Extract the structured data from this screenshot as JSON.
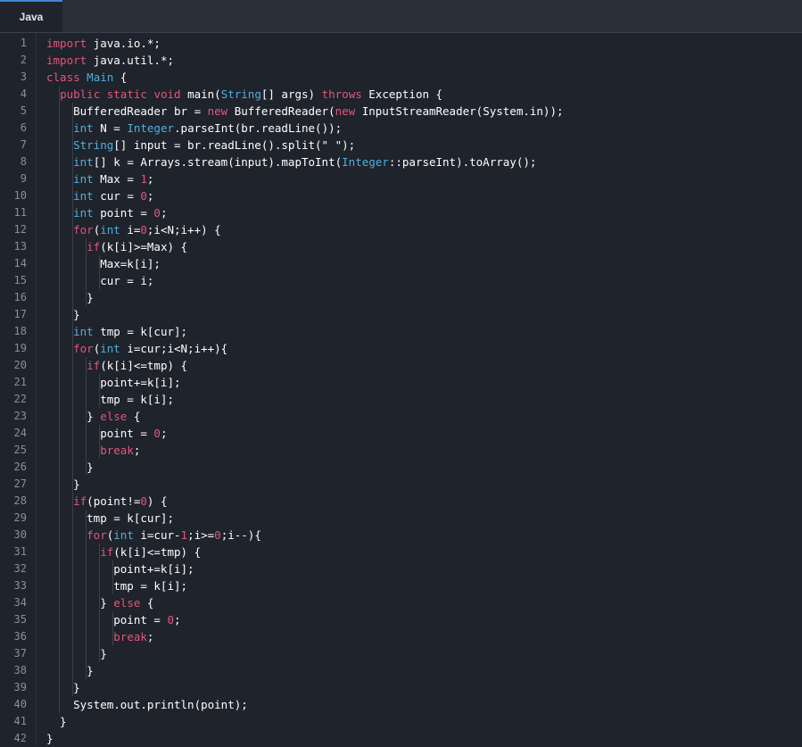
{
  "tab": {
    "label": "Java"
  },
  "colors": {
    "keyword": "#e0577c",
    "type": "#4fb0e0",
    "text": "#ffffff",
    "line_number": "#8a8f99",
    "background": "#1f232b"
  },
  "lines": [
    {
      "n": "1",
      "tokens": [
        [
          "kw",
          "import"
        ],
        [
          "pl",
          " java.io.*;"
        ]
      ]
    },
    {
      "n": "2",
      "tokens": [
        [
          "kw",
          "import"
        ],
        [
          "pl",
          " java.util.*;"
        ]
      ]
    },
    {
      "n": "3",
      "tokens": [
        [
          "kw",
          "class"
        ],
        [
          "pl",
          " "
        ],
        [
          "ty",
          "Main"
        ],
        [
          "pl",
          " {"
        ]
      ]
    },
    {
      "n": "4",
      "tokens": [
        [
          "pl",
          "  "
        ],
        [
          "kw",
          "public"
        ],
        [
          "pl",
          " "
        ],
        [
          "kw",
          "static"
        ],
        [
          "pl",
          " "
        ],
        [
          "kw",
          "void"
        ],
        [
          "pl",
          " main("
        ],
        [
          "ty",
          "String"
        ],
        [
          "pl",
          "[] args) "
        ],
        [
          "kw",
          "throws"
        ],
        [
          "pl",
          " Exception {"
        ]
      ]
    },
    {
      "n": "5",
      "tokens": [
        [
          "pl",
          "    BufferedReader br = "
        ],
        [
          "kw",
          "new"
        ],
        [
          "pl",
          " BufferedReader("
        ],
        [
          "kw",
          "new"
        ],
        [
          "pl",
          " InputStreamReader(System.in));"
        ]
      ]
    },
    {
      "n": "6",
      "tokens": [
        [
          "pl",
          "    "
        ],
        [
          "ty",
          "int"
        ],
        [
          "pl",
          " N = "
        ],
        [
          "ty",
          "Integer"
        ],
        [
          "pl",
          ".parseInt(br.readLine());"
        ]
      ]
    },
    {
      "n": "7",
      "tokens": [
        [
          "pl",
          "    "
        ],
        [
          "ty",
          "String"
        ],
        [
          "pl",
          "[] input = br.readLine().split(\" \");"
        ]
      ]
    },
    {
      "n": "8",
      "tokens": [
        [
          "pl",
          "    "
        ],
        [
          "ty",
          "int"
        ],
        [
          "pl",
          "[] k = Arrays.stream(input).mapToInt("
        ],
        [
          "ty",
          "Integer"
        ],
        [
          "pl",
          "::parseInt).toArray();"
        ]
      ]
    },
    {
      "n": "9",
      "tokens": [
        [
          "pl",
          "    "
        ],
        [
          "ty",
          "int"
        ],
        [
          "pl",
          " Max = "
        ],
        [
          "nu",
          "1"
        ],
        [
          "pl",
          ";"
        ]
      ]
    },
    {
      "n": "10",
      "tokens": [
        [
          "pl",
          "    "
        ],
        [
          "ty",
          "int"
        ],
        [
          "pl",
          " cur = "
        ],
        [
          "nu",
          "0"
        ],
        [
          "pl",
          ";"
        ]
      ]
    },
    {
      "n": "11",
      "tokens": [
        [
          "pl",
          "    "
        ],
        [
          "ty",
          "int"
        ],
        [
          "pl",
          " point = "
        ],
        [
          "nu",
          "0"
        ],
        [
          "pl",
          ";"
        ]
      ]
    },
    {
      "n": "12",
      "tokens": [
        [
          "pl",
          "    "
        ],
        [
          "kw",
          "for"
        ],
        [
          "pl",
          "("
        ],
        [
          "ty",
          "int"
        ],
        [
          "pl",
          " i="
        ],
        [
          "nu",
          "0"
        ],
        [
          "pl",
          ";i<N;i++) {"
        ]
      ]
    },
    {
      "n": "13",
      "tokens": [
        [
          "pl",
          "      "
        ],
        [
          "kw",
          "if"
        ],
        [
          "pl",
          "(k[i]>=Max) {"
        ]
      ]
    },
    {
      "n": "14",
      "tokens": [
        [
          "pl",
          "        Max=k[i];"
        ]
      ]
    },
    {
      "n": "15",
      "tokens": [
        [
          "pl",
          "        cur = i;"
        ]
      ]
    },
    {
      "n": "16",
      "tokens": [
        [
          "pl",
          "      }"
        ]
      ]
    },
    {
      "n": "17",
      "tokens": [
        [
          "pl",
          "    }"
        ]
      ]
    },
    {
      "n": "18",
      "tokens": [
        [
          "pl",
          "    "
        ],
        [
          "ty",
          "int"
        ],
        [
          "pl",
          " tmp = k[cur];"
        ]
      ]
    },
    {
      "n": "19",
      "tokens": [
        [
          "pl",
          "    "
        ],
        [
          "kw",
          "for"
        ],
        [
          "pl",
          "("
        ],
        [
          "ty",
          "int"
        ],
        [
          "pl",
          " i=cur;i<N;i++){"
        ]
      ]
    },
    {
      "n": "20",
      "tokens": [
        [
          "pl",
          "      "
        ],
        [
          "kw",
          "if"
        ],
        [
          "pl",
          "(k[i]<=tmp) {"
        ]
      ]
    },
    {
      "n": "21",
      "tokens": [
        [
          "pl",
          "        point+=k[i];"
        ]
      ]
    },
    {
      "n": "22",
      "tokens": [
        [
          "pl",
          "        tmp = k[i];"
        ]
      ]
    },
    {
      "n": "23",
      "tokens": [
        [
          "pl",
          "      } "
        ],
        [
          "kw",
          "else"
        ],
        [
          "pl",
          " {"
        ]
      ]
    },
    {
      "n": "24",
      "tokens": [
        [
          "pl",
          "        point = "
        ],
        [
          "nu",
          "0"
        ],
        [
          "pl",
          ";"
        ]
      ]
    },
    {
      "n": "25",
      "tokens": [
        [
          "pl",
          "        "
        ],
        [
          "kw",
          "break"
        ],
        [
          "pl",
          ";"
        ]
      ]
    },
    {
      "n": "26",
      "tokens": [
        [
          "pl",
          "      }"
        ]
      ]
    },
    {
      "n": "27",
      "tokens": [
        [
          "pl",
          "    }"
        ]
      ]
    },
    {
      "n": "28",
      "tokens": [
        [
          "pl",
          "    "
        ],
        [
          "kw",
          "if"
        ],
        [
          "pl",
          "(point!="
        ],
        [
          "nu",
          "0"
        ],
        [
          "pl",
          ") {"
        ]
      ]
    },
    {
      "n": "29",
      "tokens": [
        [
          "pl",
          "      tmp = k[cur];"
        ]
      ]
    },
    {
      "n": "30",
      "tokens": [
        [
          "pl",
          "      "
        ],
        [
          "kw",
          "for"
        ],
        [
          "pl",
          "("
        ],
        [
          "ty",
          "int"
        ],
        [
          "pl",
          " i=cur-"
        ],
        [
          "nu",
          "1"
        ],
        [
          "pl",
          ";i>="
        ],
        [
          "nu",
          "0"
        ],
        [
          "pl",
          ";i--){"
        ]
      ]
    },
    {
      "n": "31",
      "tokens": [
        [
          "pl",
          "        "
        ],
        [
          "kw",
          "if"
        ],
        [
          "pl",
          "(k[i]<=tmp) {"
        ]
      ]
    },
    {
      "n": "32",
      "tokens": [
        [
          "pl",
          "          point+=k[i];"
        ]
      ]
    },
    {
      "n": "33",
      "tokens": [
        [
          "pl",
          "          tmp = k[i];"
        ]
      ]
    },
    {
      "n": "34",
      "tokens": [
        [
          "pl",
          "        } "
        ],
        [
          "kw",
          "else"
        ],
        [
          "pl",
          " {"
        ]
      ]
    },
    {
      "n": "35",
      "tokens": [
        [
          "pl",
          "          point = "
        ],
        [
          "nu",
          "0"
        ],
        [
          "pl",
          ";"
        ]
      ]
    },
    {
      "n": "36",
      "tokens": [
        [
          "pl",
          "          "
        ],
        [
          "kw",
          "break"
        ],
        [
          "pl",
          ";"
        ]
      ]
    },
    {
      "n": "37",
      "tokens": [
        [
          "pl",
          "        }"
        ]
      ]
    },
    {
      "n": "38",
      "tokens": [
        [
          "pl",
          "      }"
        ]
      ]
    },
    {
      "n": "39",
      "tokens": [
        [
          "pl",
          "    }"
        ]
      ]
    },
    {
      "n": "40",
      "tokens": [
        [
          "pl",
          "    System.out.println(point);"
        ]
      ]
    },
    {
      "n": "41",
      "tokens": [
        [
          "pl",
          "  }"
        ]
      ]
    },
    {
      "n": "42",
      "tokens": [
        [
          "pl",
          "}"
        ]
      ]
    }
  ]
}
